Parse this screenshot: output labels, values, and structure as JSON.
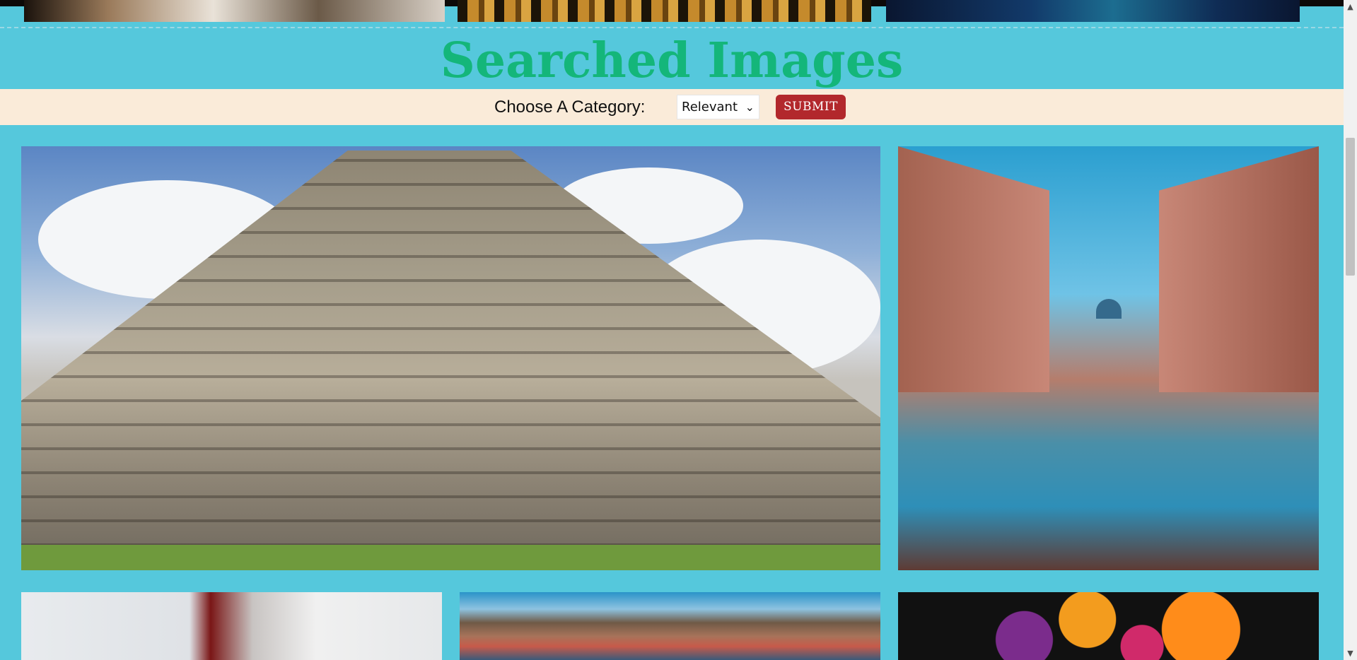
{
  "page": {
    "heading": "Searched Images",
    "accent_color": "#14b67a",
    "background_color": "#55c8dc"
  },
  "category_bar": {
    "label": "Choose A Category:",
    "select_value": "Relevant",
    "select_icon": "chevron-down-icon",
    "submit_label": "SUBMIT",
    "submit_color": "#b2282c"
  },
  "gallery": {
    "images": [
      {
        "description": "pyramid",
        "icon": "image"
      },
      {
        "description": "colonial-street-reflection",
        "icon": "image"
      },
      {
        "description": "fabric",
        "icon": "image"
      },
      {
        "description": "hillside-city",
        "icon": "image"
      },
      {
        "description": "flowers",
        "icon": "image"
      }
    ]
  },
  "scrollbar": {
    "up_icon": "scroll-up-arrow-icon",
    "down_icon": "scroll-down-arrow-icon"
  }
}
